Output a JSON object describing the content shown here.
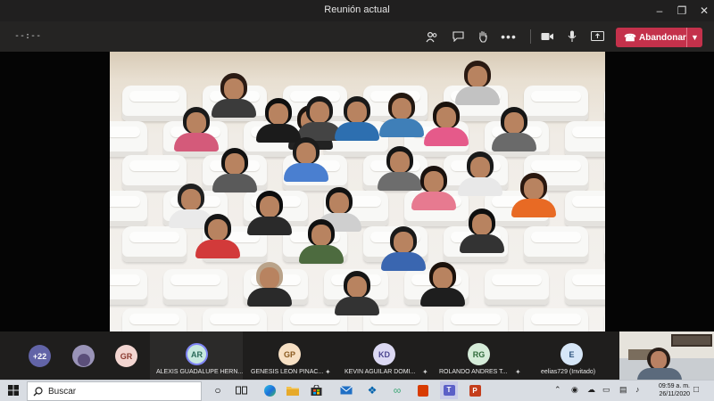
{
  "window": {
    "title": "Reunión actual"
  },
  "toolbar": {
    "timer": "--:--",
    "leave_label": "Abandonar"
  },
  "participants_overflow": "+22",
  "participants": [
    {
      "initials": "GR",
      "name": "",
      "color": "#f3d6d1",
      "text_color": "#8a3a2f"
    },
    {
      "initials": "AR",
      "name": "ALEXIS GUADALUPE HERN...",
      "color": "#c8e8df",
      "text_color": "#2b6a5a",
      "active": true
    },
    {
      "initials": "GP",
      "name": "GENESIS LEON PINAC...",
      "color": "#f7e0c4",
      "text_color": "#8a5a1f",
      "muted": true
    },
    {
      "initials": "KD",
      "name": "KEVIN AGUILAR DOMI...",
      "color": "#dcd9f3",
      "text_color": "#4c4690",
      "muted": true
    },
    {
      "initials": "RG",
      "name": "ROLANDO ANDRES T...",
      "color": "#d5ecd9",
      "text_color": "#2f6a3a",
      "muted": true
    },
    {
      "initials": "E",
      "name": "eelias729 (Invitado)",
      "color": "#d6e6f7",
      "text_color": "#2f557f",
      "muted": false
    }
  ],
  "taskbar": {
    "search_placeholder": "Buscar",
    "time": "09:59 a. m.",
    "date": "26/11/2020"
  },
  "colors": {
    "leave": "#c4314b",
    "toolbar": "#252423",
    "titlebar": "#201f1f"
  }
}
